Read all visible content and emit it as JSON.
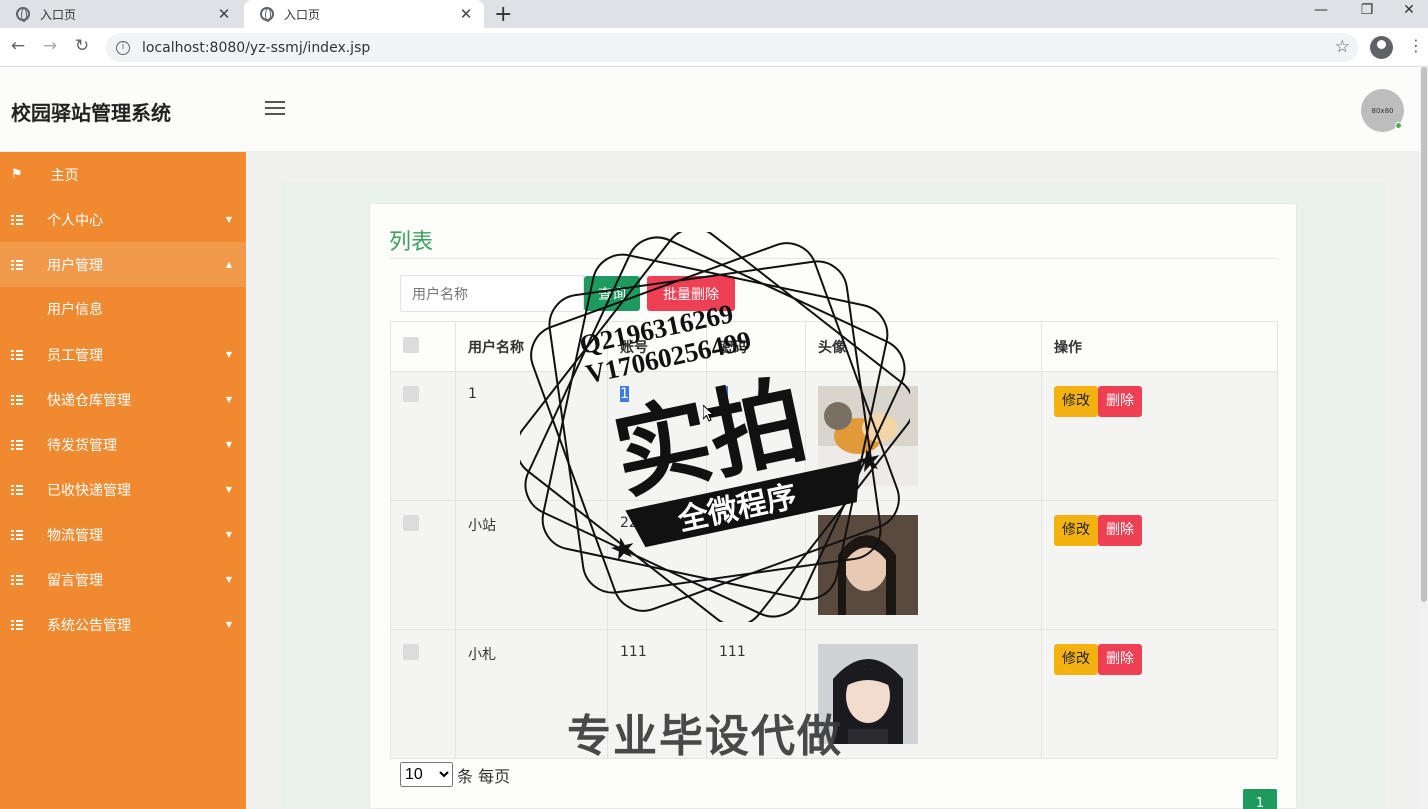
{
  "browser": {
    "tabs": [
      {
        "title": "入口页",
        "close": "✕"
      },
      {
        "title": "入口页",
        "close": "✕"
      }
    ],
    "new_tab": "+",
    "window_controls": {
      "minimize": "—",
      "restore": "❐",
      "close": "✕"
    },
    "url": "localhost:8080/yz-ssmj/index.jsp",
    "nav": {
      "back": "←",
      "forward": "→",
      "reload": "↻",
      "bookmark": "☆",
      "menu": "⋮"
    }
  },
  "app": {
    "title": "校园驿站管理系统",
    "avatar_text": "80x80"
  },
  "sidebar": {
    "items": [
      {
        "label": "主页",
        "icon": "flag-icon"
      },
      {
        "label": "个人中心",
        "icon": "grid-icon"
      },
      {
        "label": "用户管理",
        "icon": "grid-icon",
        "open": true
      },
      {
        "label": "用户信息",
        "sub": true
      },
      {
        "label": "员工管理",
        "icon": "grid-icon"
      },
      {
        "label": "快递仓库管理",
        "icon": "grid-icon"
      },
      {
        "label": "待发货管理",
        "icon": "grid-icon"
      },
      {
        "label": "已收快递管理",
        "icon": "grid-icon"
      },
      {
        "label": "物流管理",
        "icon": "grid-icon"
      },
      {
        "label": "留言管理",
        "icon": "grid-icon"
      },
      {
        "label": "系统公告管理",
        "icon": "grid-icon"
      }
    ],
    "caret_down": "▼",
    "caret_up": "▲"
  },
  "main": {
    "title": "列表",
    "search": {
      "placeholder": "用户名称",
      "button": "查询"
    },
    "batch_delete": "批量删除",
    "table": {
      "headers": [
        "用户名称",
        "账号",
        "密码",
        "头像",
        "操作"
      ],
      "rows": [
        {
          "username": "1",
          "account": "1",
          "password": "1"
        },
        {
          "username": "小站",
          "account": "222",
          "password": ""
        },
        {
          "username": "小札",
          "account": "111",
          "password": "111"
        }
      ],
      "edit_label": "修改",
      "delete_label": "删除"
    },
    "pagination": {
      "page_size": "10",
      "page_size_suffix": "条 每页",
      "current_page": "1"
    }
  },
  "watermark": {
    "line1": "Q2196316269",
    "line2": "V17060256499",
    "big": "实拍",
    "banner": "全微程序",
    "bottom": "专业毕设代做"
  },
  "colors": {
    "sidebar": "#ef8a30",
    "accent_green": "#1e9a5f",
    "danger": "#ef3f52",
    "warning": "#f3b20f",
    "title_green": "#3ea05a"
  }
}
